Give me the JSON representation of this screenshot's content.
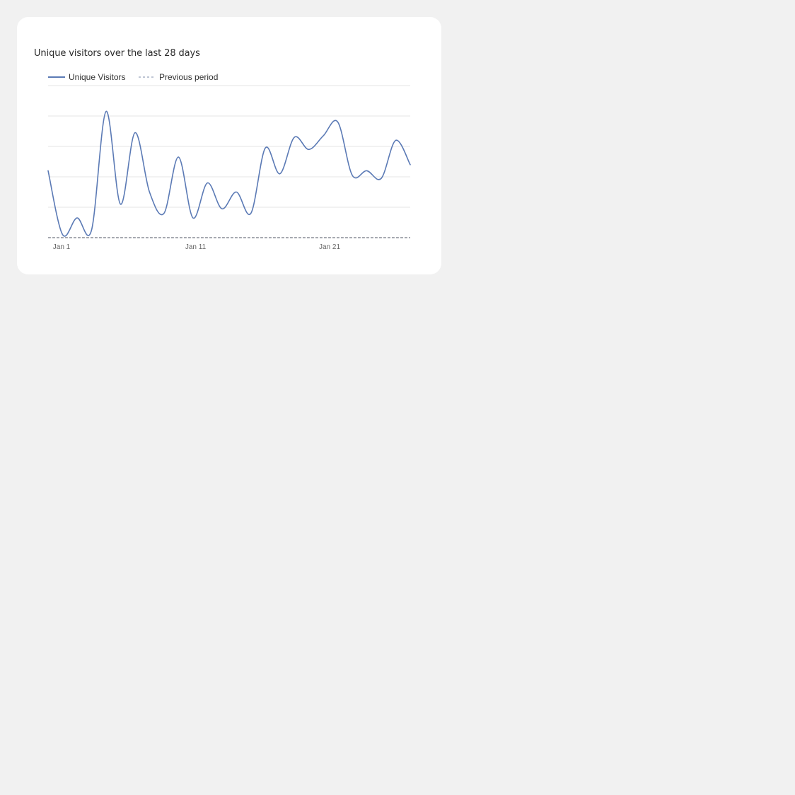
{
  "card": {
    "title": "Unique visitors over the last 28 days"
  },
  "colors": {
    "series": "#5b7ab5",
    "previous": "#a9b2c6",
    "grid": "#e4e4e4",
    "baseline": "#2f3440"
  },
  "chart_data": {
    "type": "line",
    "title": "Unique visitors over the last 28 days",
    "xlabel": "",
    "ylabel": "",
    "x": [
      "Jan 1",
      "Jan 2",
      "Jan 3",
      "Jan 4",
      "Jan 5",
      "Jan 6",
      "Jan 7",
      "Jan 8",
      "Jan 9",
      "Jan 10",
      "Jan 11",
      "Jan 12",
      "Jan 13",
      "Jan 14",
      "Jan 15",
      "Jan 16",
      "Jan 17",
      "Jan 18",
      "Jan 19",
      "Jan 20",
      "Jan 21",
      "Jan 22",
      "Jan 23",
      "Jan 24",
      "Jan 25",
      "Jan 26",
      "Jan 27",
      "Jan 28"
    ],
    "x_ticks": [
      "Jan 1",
      "Jan 11",
      "Jan 21"
    ],
    "ylim": [
      0,
      100
    ],
    "grid": true,
    "legend": "top-left",
    "series": [
      {
        "name": "Unique Visitors",
        "style": "solid",
        "values": [
          44,
          2,
          13,
          5,
          83,
          22,
          69,
          30,
          16,
          53,
          13,
          36,
          19,
          30,
          16,
          59,
          42,
          66,
          58,
          67,
          76,
          41,
          44,
          39,
          64,
          48
        ]
      },
      {
        "name": "Previous period",
        "style": "dashed",
        "values": [
          0,
          0,
          0,
          0,
          0,
          0,
          0,
          0,
          0,
          0,
          0,
          0,
          0,
          0,
          0,
          0,
          0,
          0,
          0,
          0,
          0,
          0,
          0,
          0,
          0,
          0,
          0,
          0
        ]
      }
    ]
  }
}
